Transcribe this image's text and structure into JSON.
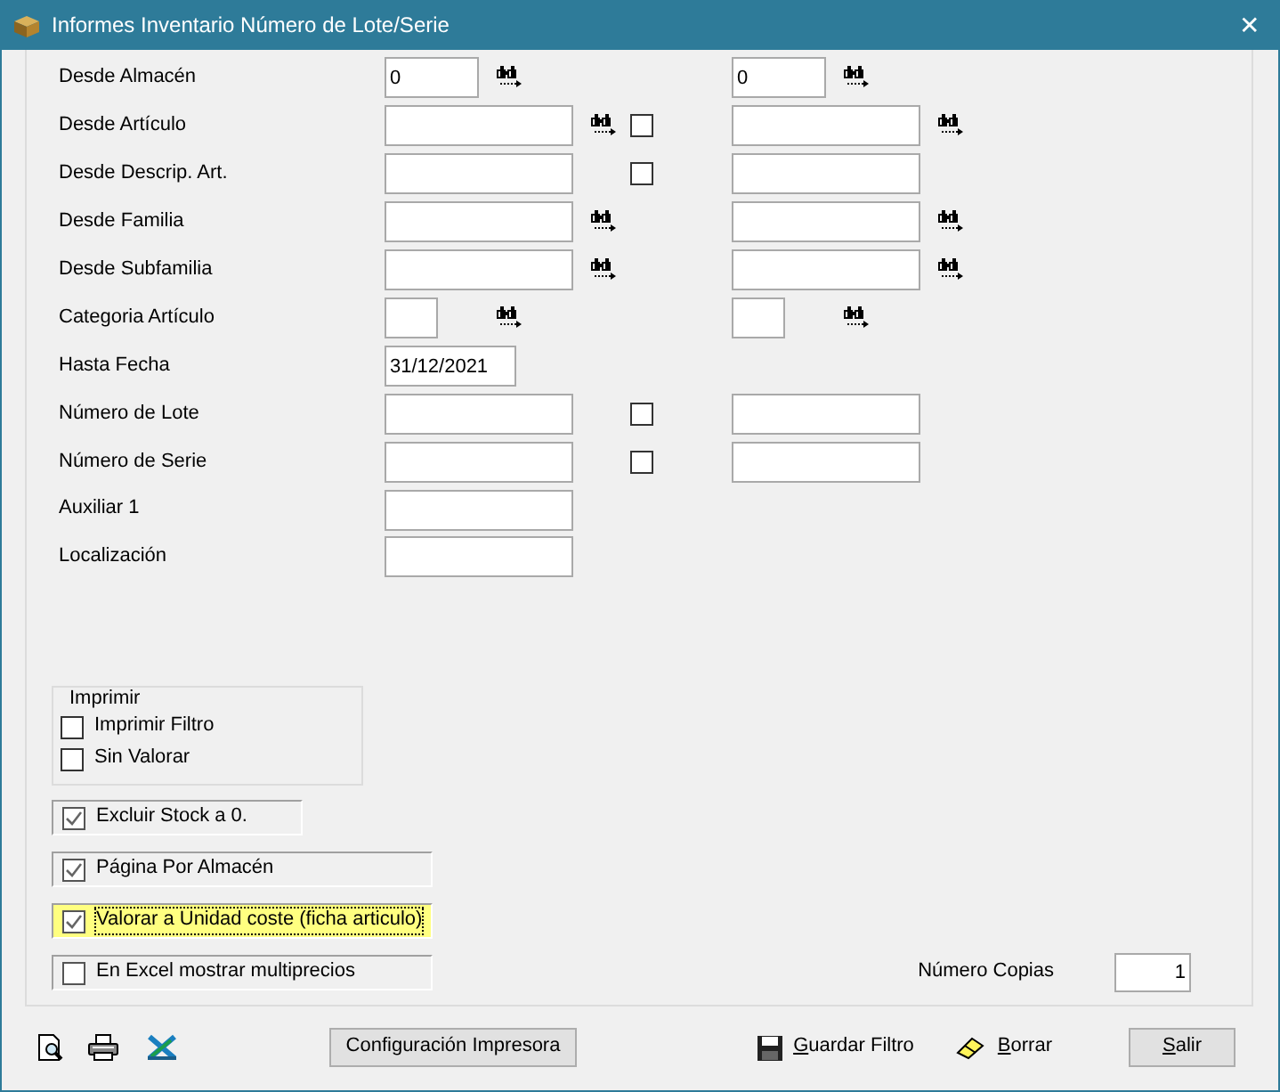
{
  "window": {
    "title": "Informes Inventario Número de Lote/Serie",
    "close": "✕"
  },
  "filters": [
    {
      "label": "Desde Almacén",
      "from": {
        "kind": "code",
        "value": "0",
        "search": true
      },
      "to": {
        "kind": "code",
        "value": "0",
        "search": true
      }
    },
    {
      "label": "Desde Artículo",
      "from": {
        "kind": "text",
        "search": true
      },
      "checkbox": {
        "checked": false
      },
      "to": {
        "kind": "text",
        "search": true
      }
    },
    {
      "label": "Desde Descrip. Art.",
      "from": {
        "kind": "text",
        "search": false
      },
      "checkbox": {
        "checked": false
      },
      "to": {
        "kind": "text",
        "search": false
      }
    },
    {
      "label": "Desde Familia",
      "from": {
        "kind": "text",
        "search": true
      },
      "to": {
        "kind": "text",
        "search": true
      }
    },
    {
      "label": "Desde Subfamilia",
      "from": {
        "kind": "text",
        "search": true
      },
      "to": {
        "kind": "text",
        "search": true
      }
    },
    {
      "label": "Categoria Artículo",
      "from": {
        "kind": "tiny",
        "search": true
      },
      "to": {
        "kind": "tiny",
        "search": true
      }
    },
    {
      "label": "Hasta Fecha",
      "from": {
        "kind": "date",
        "value": "31/12/2021",
        "search": false
      }
    },
    {
      "label": "Número de Lote",
      "from": {
        "kind": "text",
        "search": false
      },
      "checkbox": {
        "checked": false
      },
      "to": {
        "kind": "text",
        "search": false
      }
    },
    {
      "label": "Número de Serie",
      "from": {
        "kind": "text",
        "search": false
      },
      "checkbox": {
        "checked": false
      },
      "to": {
        "kind": "text",
        "search": false
      }
    },
    {
      "label": "Auxiliar 1",
      "from": {
        "kind": "text",
        "search": false
      }
    },
    {
      "label": "Localización",
      "from": {
        "kind": "text",
        "search": false
      }
    }
  ],
  "print_group": {
    "title": "Imprimir",
    "options": [
      {
        "label": "Imprimir Filtro",
        "checked": false
      },
      {
        "label": "Sin Valorar",
        "checked": false
      }
    ]
  },
  "options": [
    {
      "label": "Excluir Stock a 0.",
      "checked": true,
      "highlighted": false
    },
    {
      "label": "Página Por Almacén",
      "checked": true,
      "highlighted": false
    },
    {
      "label": "Valorar a Unidad coste (ficha articulo)",
      "checked": true,
      "highlighted": true
    },
    {
      "label": "En Excel mostrar multiprecios",
      "checked": false,
      "highlighted": false
    }
  ],
  "copies": {
    "label": "Número Copias",
    "value": "1"
  },
  "actions": [
    {
      "label": "Configuración Impresora",
      "kind": "button"
    },
    {
      "label": "Guardar Filtro",
      "kind": "save"
    },
    {
      "label": "Borrar",
      "kind": "erase"
    },
    {
      "label": "Salir",
      "kind": "button"
    }
  ]
}
